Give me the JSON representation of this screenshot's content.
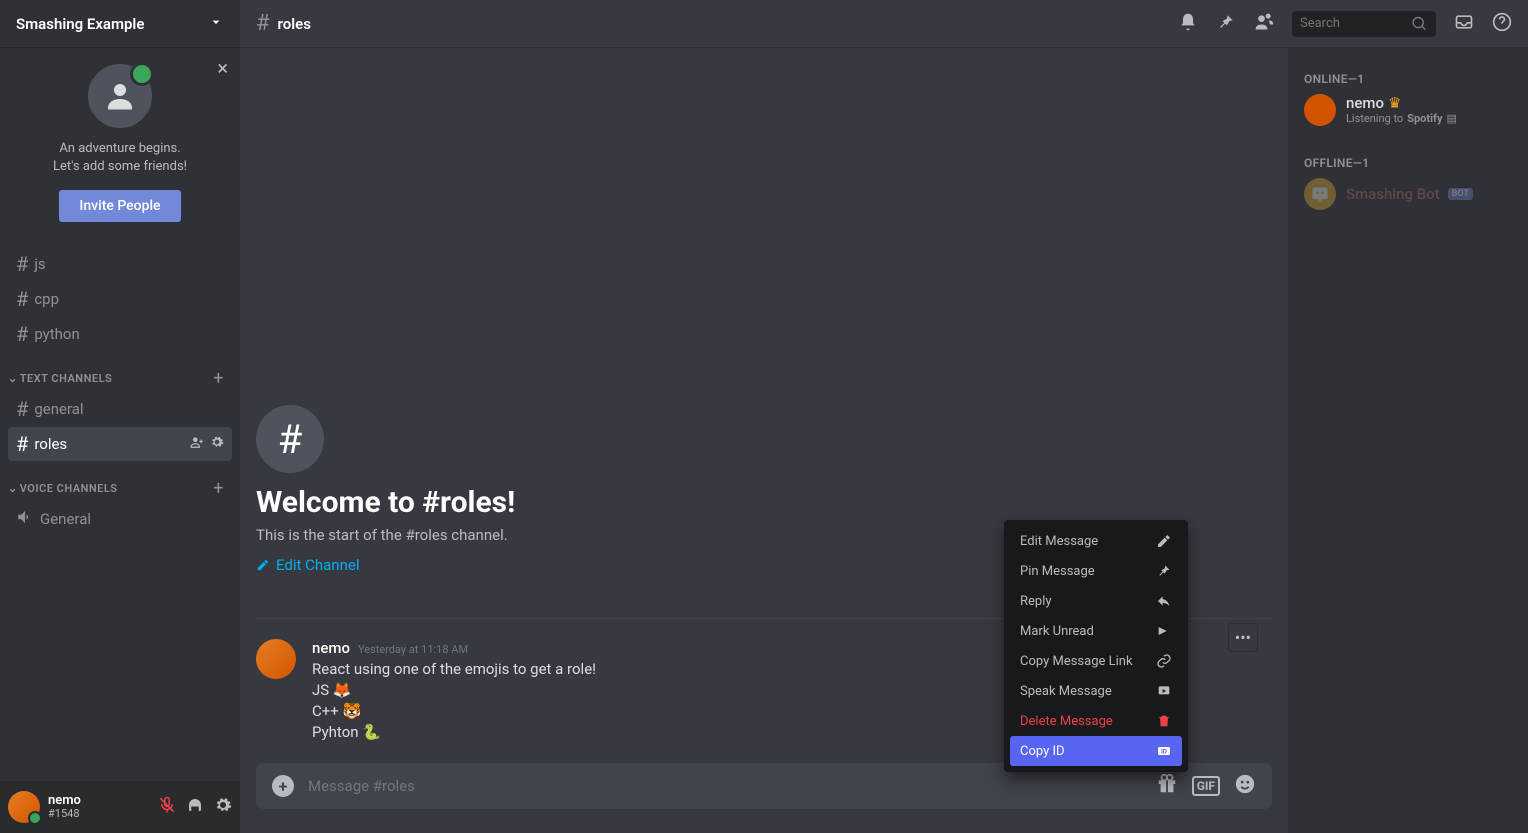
{
  "server": {
    "name": "Smashing Example"
  },
  "invite": {
    "line1": "An adventure begins.",
    "line2": "Let's add some friends!",
    "button": "Invite People"
  },
  "channels": {
    "plain": [
      "js",
      "cpp",
      "python"
    ],
    "text_label": "TEXT CHANNELS",
    "text": [
      "general",
      "roles"
    ],
    "selected": "roles",
    "voice_label": "VOICE CHANNELS",
    "voice": [
      "General"
    ]
  },
  "user_panel": {
    "name": "nemo",
    "tag": "#1548"
  },
  "header": {
    "channel": "roles",
    "search_placeholder": "Search"
  },
  "welcome": {
    "title": "Welcome to #roles!",
    "subtitle": "This is the start of the #roles channel.",
    "edit": "Edit Channel"
  },
  "message": {
    "author": "nemo",
    "timestamp": "Yesterday at 11:18 AM",
    "lines": [
      "React using one of the emojis to get a role!",
      "JS 🦊",
      "C++ 🐯",
      "Pyhton 🐍"
    ]
  },
  "composer": {
    "placeholder": "Message #roles"
  },
  "members": {
    "online_label": "ONLINE—1",
    "online": [
      {
        "name": "nemo",
        "status_pre": "Listening to ",
        "status_app": "Spotify",
        "crown": true
      }
    ],
    "offline_label": "OFFLINE—1",
    "offline": [
      {
        "name": "Smashing Bot",
        "bot": true
      }
    ]
  },
  "context_menu": {
    "items": [
      {
        "label": "Edit Message",
        "icon": "pencil"
      },
      {
        "label": "Pin Message",
        "icon": "pin"
      },
      {
        "label": "Reply",
        "icon": "reply"
      },
      {
        "label": "Mark Unread",
        "icon": "unread"
      },
      {
        "label": "Copy Message Link",
        "icon": "link"
      },
      {
        "label": "Speak Message",
        "icon": "speak"
      },
      {
        "label": "Delete Message",
        "icon": "trash",
        "danger": true
      },
      {
        "label": "Copy ID",
        "icon": "id",
        "selected": true
      }
    ]
  }
}
